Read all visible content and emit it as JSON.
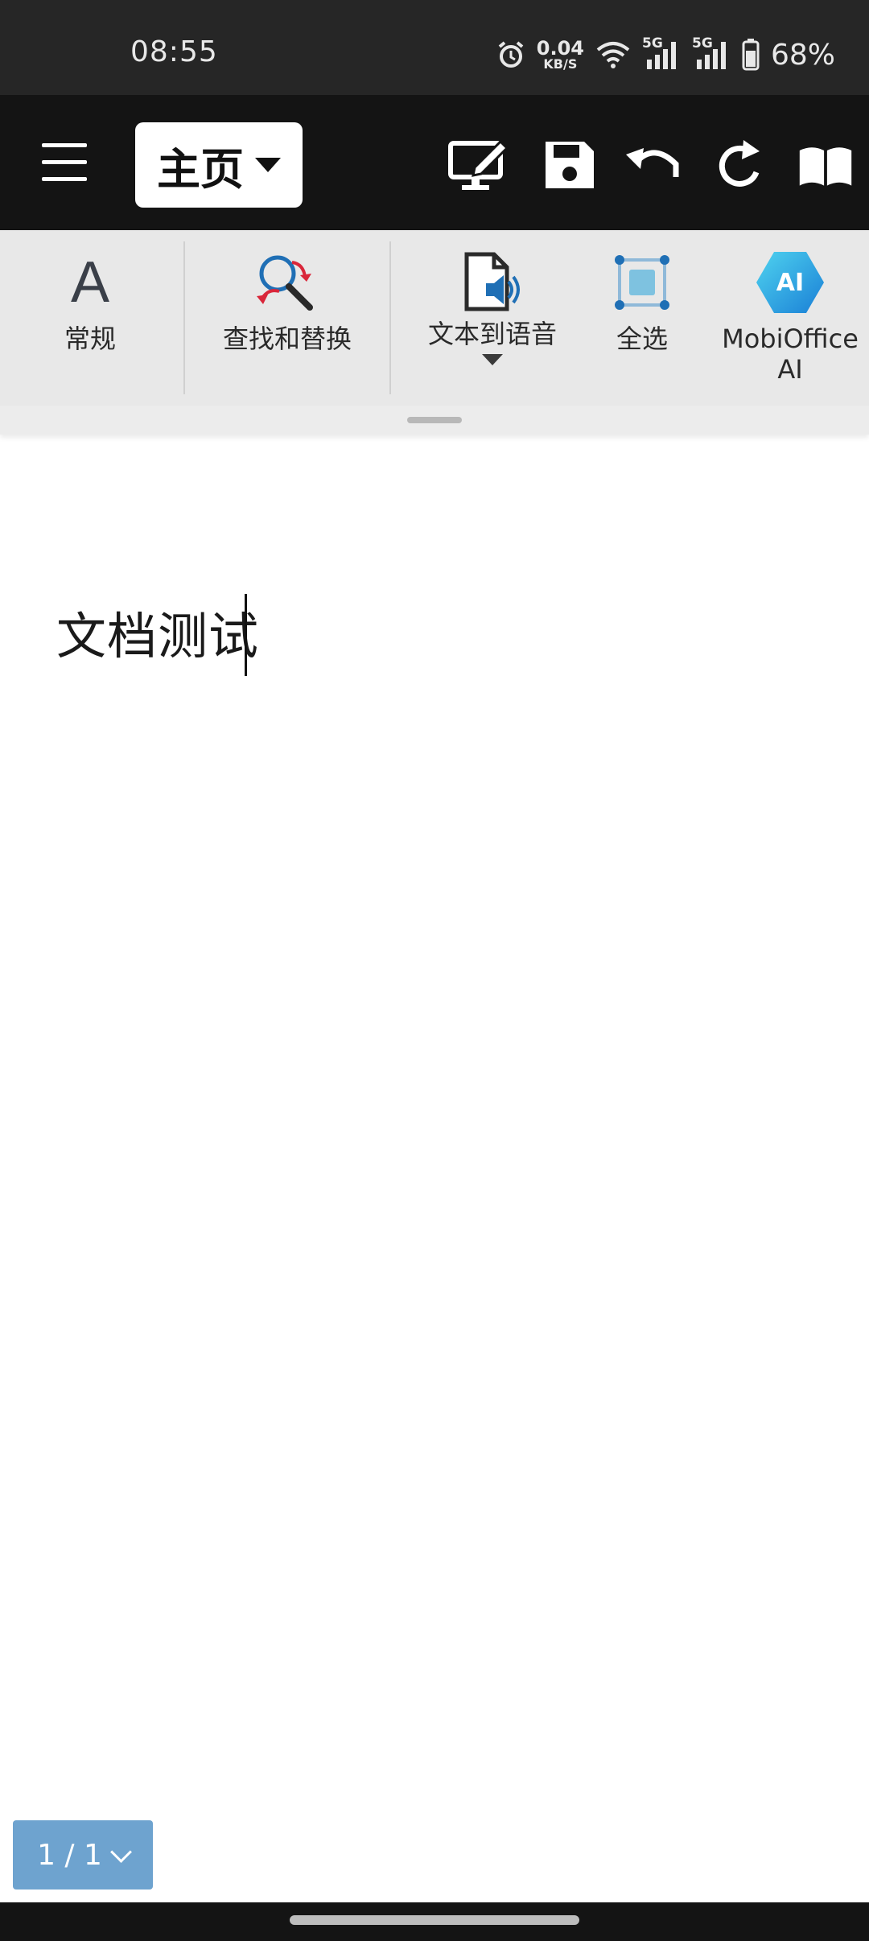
{
  "status_bar": {
    "time": "08:55",
    "net_speed_value": "0.04",
    "net_speed_unit": "KB/S",
    "sim1_label": "5G",
    "sim2_label": "5G",
    "battery": "68%"
  },
  "toolbar": {
    "tab_label": "主页",
    "icons": [
      "screen-edit-icon",
      "save-icon",
      "undo-icon",
      "redo-icon",
      "read-mode-icon"
    ]
  },
  "ribbon": {
    "items": [
      {
        "label": "常规",
        "icon": "font-style-icon"
      },
      {
        "label": "查找和替换",
        "icon": "find-replace-icon"
      },
      {
        "label": "文本到语音",
        "icon": "text-to-speech-icon"
      },
      {
        "label": "全选",
        "icon": "select-all-icon"
      },
      {
        "label": "MobiOffice AI",
        "icon": "ai-icon",
        "icon_text": "AI"
      }
    ],
    "font_icon_glyph": "A"
  },
  "document": {
    "text": "文档测试"
  },
  "page_indicator": {
    "label": "1 / 1"
  },
  "colors": {
    "status_bg": "#262626",
    "toolbar_bg": "#141414",
    "ribbon_bg": "#e8e8e8",
    "page_indicator_bg": "#6ea3cf",
    "accent_red": "#d9263a",
    "accent_blue": "#1f6fb5"
  }
}
